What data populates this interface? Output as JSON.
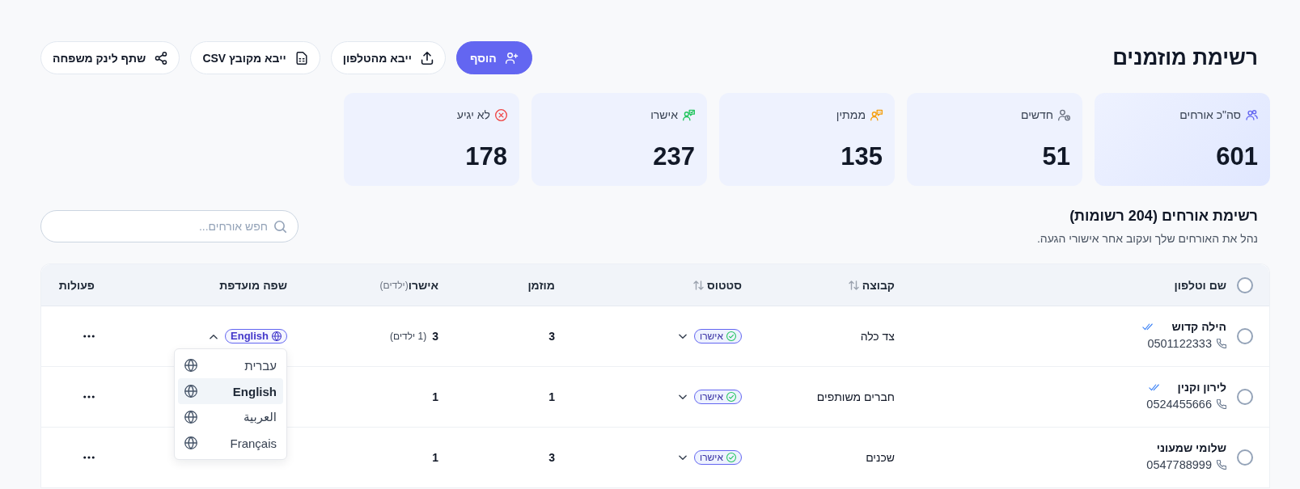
{
  "page": {
    "title": "רשימת מוזמנים"
  },
  "actions": [
    {
      "label": "הוסף",
      "kind": "add",
      "primary": true
    },
    {
      "label": "ייבא מהטלפון",
      "kind": "upload",
      "primary": false
    },
    {
      "label": "ייבא מקובץ CSV",
      "kind": "csv",
      "primary": false
    },
    {
      "label": "שתף לינק משפחה",
      "kind": "share",
      "primary": false
    }
  ],
  "stats": [
    {
      "label": "סה\"כ אורחים",
      "value": "601",
      "kind": "total",
      "selected": true
    },
    {
      "label": "חדשים",
      "value": "51",
      "kind": "new",
      "selected": false
    },
    {
      "label": "ממתין",
      "value": "135",
      "kind": "waiting",
      "selected": false
    },
    {
      "label": "אישרו",
      "value": "237",
      "kind": "approved",
      "selected": false
    },
    {
      "label": "לא יגיע",
      "value": "178",
      "kind": "declined",
      "selected": false
    }
  ],
  "guest_list": {
    "title": "רשימת אורחים (204 רשומות)",
    "subtitle": "נהל את האורחים שלך ועקוב אחר אישורי הגעה.",
    "search": {
      "placeholder": "חפש אורחים..."
    }
  },
  "table": {
    "select_all": {
      "checked": false
    },
    "columns": [
      {
        "label": "שם וטלפון",
        "sortable": false
      },
      {
        "label": "קבוצה",
        "sortable": true
      },
      {
        "label": "סטטוס",
        "sortable": true
      },
      {
        "label": "מוזמן",
        "sortable": false
      },
      {
        "label": "אישרו",
        "note": "(ילדים)",
        "sortable": false
      },
      {
        "label": "שפה מועדפת",
        "sortable": false
      },
      {
        "label": "פעולות",
        "sortable": false
      }
    ],
    "rows": [
      {
        "selected": false,
        "name": "הילה קדוש",
        "read": true,
        "phone": "0501122333",
        "group": "צד כלה",
        "status": {
          "label": "אישרו",
          "kind": "approved"
        },
        "invited": "3",
        "approved": "3",
        "children_note": "(1 ילדים)",
        "language": {
          "label": "English",
          "expanded": true,
          "options": [
            {
              "label": "עברית",
              "selected": false
            },
            {
              "label": "English",
              "selected": true
            },
            {
              "label": "العربية",
              "selected": false
            },
            {
              "label": "Français",
              "selected": false
            }
          ]
        }
      },
      {
        "selected": false,
        "name": "לירון וקנין",
        "read": true,
        "phone": "0524455666",
        "group": "חברים משותפים",
        "status": {
          "label": "אישרו",
          "kind": "approved"
        },
        "invited": "1",
        "approved": "1"
      },
      {
        "selected": false,
        "name": "שלומי שמעוני",
        "read": false,
        "phone": "0547788999",
        "group": "שכנים",
        "status": {
          "label": "אישרו",
          "kind": "approved"
        },
        "invited": "3",
        "approved": "1"
      }
    ]
  }
}
